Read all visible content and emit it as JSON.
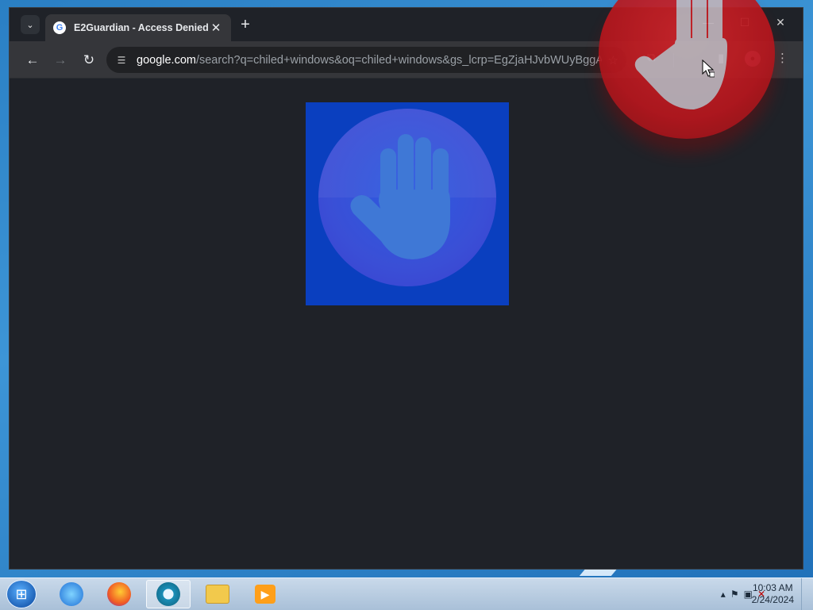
{
  "browser": {
    "tab": {
      "title": "E2Guardian - Access Denied",
      "favicon": "google-g-icon"
    },
    "url_host": "google.com",
    "url_rest": "/search?q=chiled+windows&oq=chiled+windows&gs_lcrp=EgZjaHJvbWUyBggA...",
    "controls": {
      "minimize": "—",
      "maximize": "☐",
      "close": "✕"
    }
  },
  "content": {
    "image": "stop-hand-blocked-image"
  },
  "taskbar": {
    "apps": [
      "internet-explorer",
      "firefox",
      "chrome",
      "file-explorer",
      "media-player"
    ],
    "time": "10:03 AM",
    "date": "2/24/2024"
  },
  "colors": {
    "window_bg": "#1f2228",
    "block_bg": "#0a3fbf",
    "overlay_red": "#c0181f"
  }
}
